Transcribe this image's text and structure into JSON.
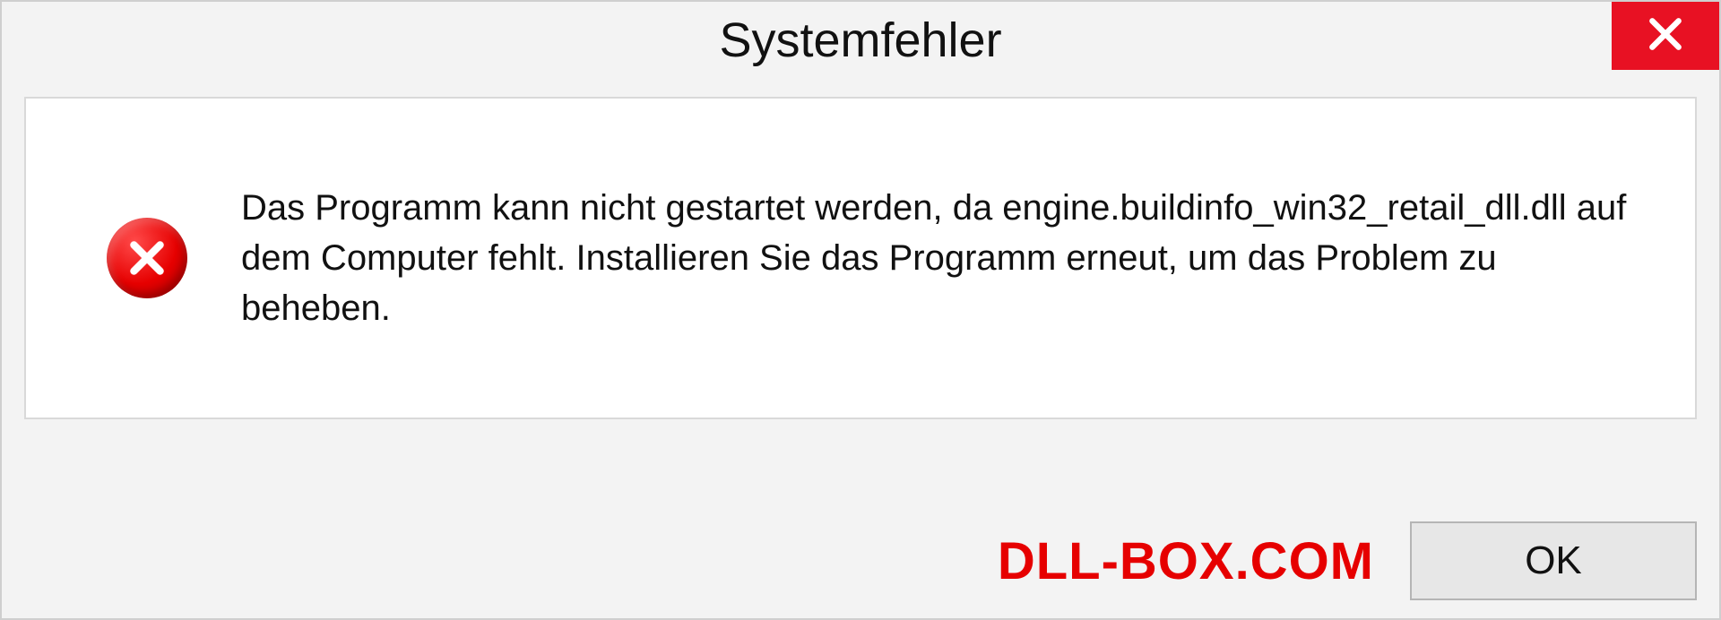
{
  "dialog": {
    "title": "Systemfehler",
    "message": "Das Programm kann nicht gestartet werden, da engine.buildinfo_win32_retail_dll.dll auf dem Computer fehlt. Installieren Sie das Programm erneut, um das Problem zu beheben.",
    "ok_label": "OK"
  },
  "watermark": "DLL-BOX.COM",
  "colors": {
    "close_bg": "#e81123",
    "error_red": "#e60000",
    "panel_bg": "#f3f3f3",
    "content_bg": "#ffffff"
  }
}
